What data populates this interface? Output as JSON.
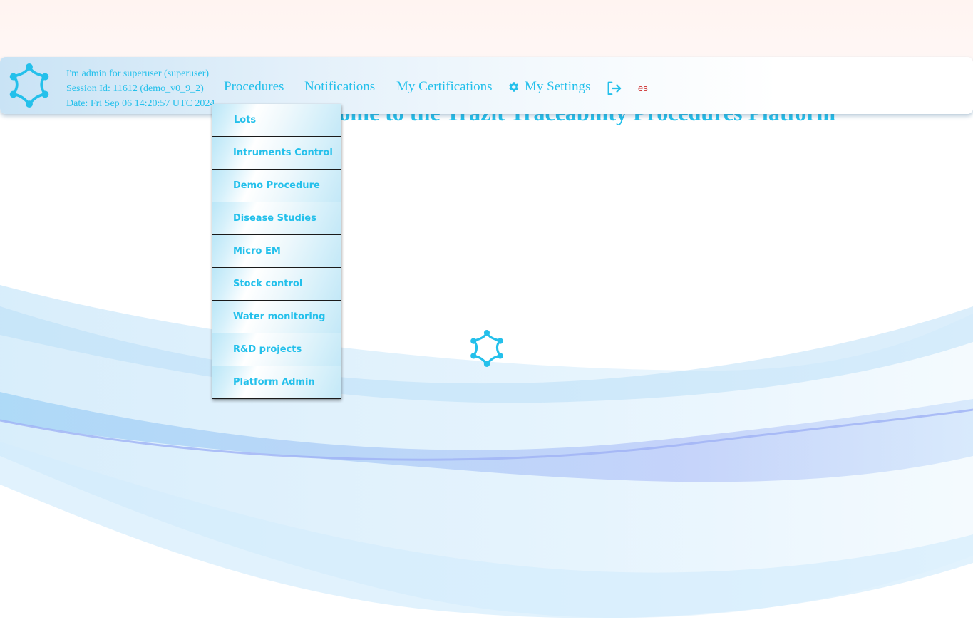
{
  "page": {
    "welcome_title": "Welcome to the Trazit Traceability Procedures Platform"
  },
  "header": {
    "user_line": "I'm admin for superuser (superuser)",
    "session_line": "Session Id: 11612 (demo_v0_9_2)",
    "date_line": "Date: Fri Sep 06 14:20:57 UTC 2024",
    "nav": {
      "procedures": "Procedures",
      "notifications": "Notifications",
      "certifications": "My Certifications",
      "settings": "My Settings"
    },
    "language": "es"
  },
  "procedures_menu": {
    "items": [
      "Lots",
      "Intruments Control",
      "Demo Procedure",
      "Disease Studies",
      "Micro EM",
      "Stock control",
      "Water monitoring",
      "R&D projects",
      "Platform Admin"
    ]
  },
  "icons": {
    "logo": "trazit-logo-icon",
    "settings": "gear-icon",
    "logout": "logout-icon"
  },
  "colors": {
    "accent": "#24c0eb",
    "language": "#cc2b2b"
  }
}
